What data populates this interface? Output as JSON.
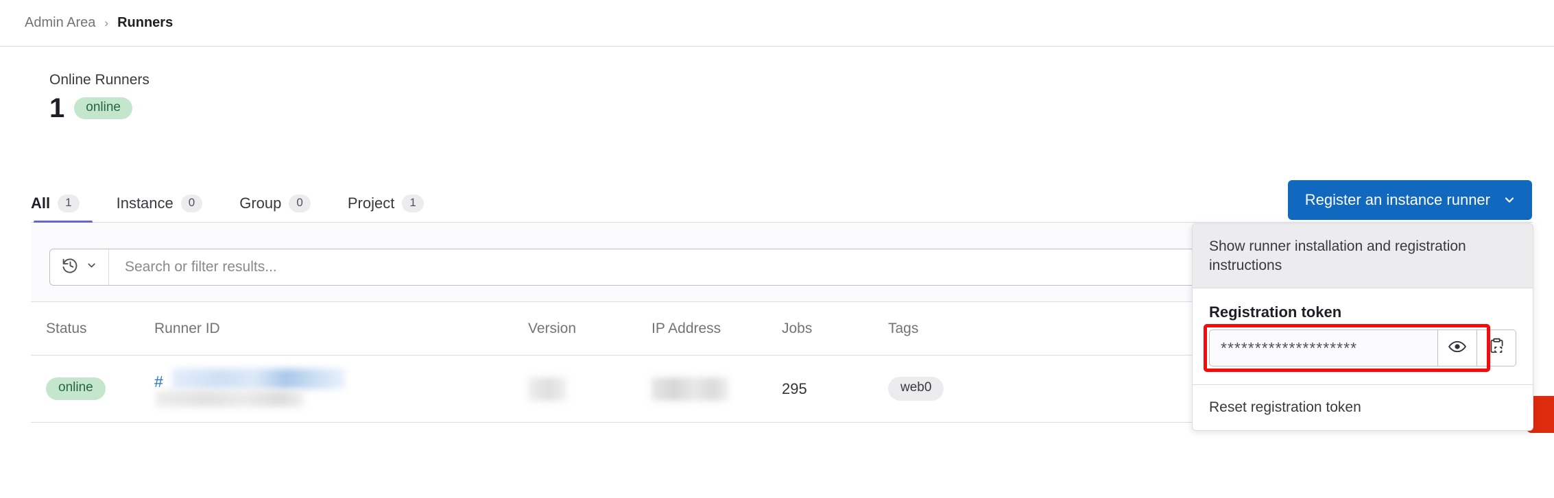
{
  "breadcrumb": {
    "parent": "Admin Area",
    "separator": "›",
    "current": "Runners"
  },
  "stats": {
    "label": "Online Runners",
    "count": "1",
    "badge": "online"
  },
  "tabs": [
    {
      "label": "All",
      "count": "1",
      "active": true
    },
    {
      "label": "Instance",
      "count": "0",
      "active": false
    },
    {
      "label": "Group",
      "count": "0",
      "active": false
    },
    {
      "label": "Project",
      "count": "1",
      "active": false
    }
  ],
  "register_button": {
    "label": "Register an instance runner",
    "icon": "chevron-down-icon"
  },
  "filter": {
    "history_icon": "history-rewind-icon",
    "history_chevron": "chevron-down-icon",
    "placeholder": "Search or filter results..."
  },
  "table": {
    "headers": {
      "status": "Status",
      "runner_id": "Runner ID",
      "version": "Version",
      "ip_address": "IP Address",
      "jobs": "Jobs",
      "tags": "Tags"
    },
    "rows": [
      {
        "status": "online",
        "runner_id_prefix": "#",
        "runner_id_redacted": true,
        "version_redacted": true,
        "ip_address_redacted": true,
        "jobs": "295",
        "tag": "web0"
      }
    ]
  },
  "dropdown": {
    "instructions_item": "Show runner installation and registration instructions",
    "token_section_title": "Registration token",
    "token_value": "********************",
    "reveal_icon": "eye-icon",
    "copy_icon": "clipboard-copy-icon",
    "reset_item": "Reset registration token"
  },
  "colors": {
    "accent_blue": "#1068bf",
    "tab_underline": "#6666c4",
    "badge_green_bg": "#c3e6cd",
    "badge_green_text": "#24663b",
    "annotation_red": "#f40b0b",
    "marker_red": "#dd2b0e"
  }
}
